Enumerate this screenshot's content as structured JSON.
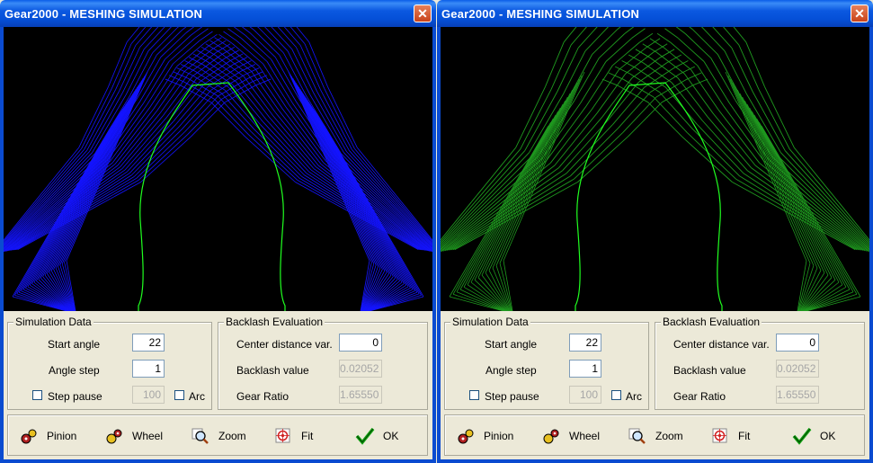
{
  "windows": [
    {
      "title": "Gear2000 - MESHING SIMULATION",
      "close_glyph": "✕",
      "plot_color": "#1414ff",
      "simulation_data": {
        "legend": "Simulation Data",
        "start_angle_label": "Start angle",
        "start_angle": "22",
        "angle_step_label": "Angle step",
        "angle_step": "1",
        "step_pause_label": "Step pause",
        "step_pause": "100",
        "arc_label": "Arc"
      },
      "backlash": {
        "legend": "Backlash Evaluation",
        "center_distance_label": "Center distance var.",
        "center_distance": "0",
        "backlash_value_label": "Backlash value",
        "backlash_value": "0.02052",
        "gear_ratio_label": "Gear Ratio",
        "gear_ratio": "1.65550"
      },
      "toolbar": {
        "pinion": "Pinion",
        "wheel": "Wheel",
        "zoom": "Zoom",
        "fit": "Fit",
        "ok": "OK"
      }
    },
    {
      "title": "Gear2000 - MESHING SIMULATION",
      "close_glyph": "✕",
      "plot_color": "#1f9a1f",
      "simulation_data": {
        "legend": "Simulation Data",
        "start_angle_label": "Start angle",
        "start_angle": "22",
        "angle_step_label": "Angle step",
        "angle_step": "1",
        "step_pause_label": "Step pause",
        "step_pause": "100",
        "arc_label": "Arc"
      },
      "backlash": {
        "legend": "Backlash Evaluation",
        "center_distance_label": "Center distance var.",
        "center_distance": "0",
        "backlash_value_label": "Backlash value",
        "backlash_value": "0.02052",
        "gear_ratio_label": "Gear Ratio",
        "gear_ratio": "1.65550"
      },
      "toolbar": {
        "pinion": "Pinion",
        "wheel": "Wheel",
        "zoom": "Zoom",
        "fit": "Fit",
        "ok": "OK"
      }
    }
  ],
  "icons": {
    "close": "close-icon",
    "pinion": "pinion-gear-icon",
    "wheel": "wheel-gear-icon",
    "zoom": "zoom-magnifier-icon",
    "fit": "fit-target-icon",
    "ok": "checkmark-icon"
  },
  "colors": {
    "title_bar": "#0550d8",
    "pinion_profile": "#20ff20",
    "canvas_bg": "#000000"
  }
}
